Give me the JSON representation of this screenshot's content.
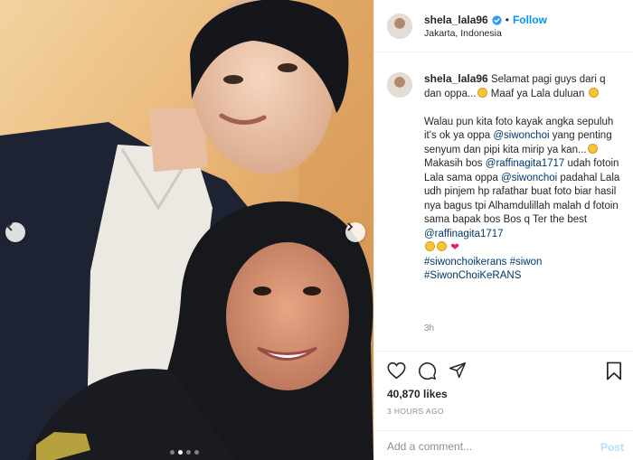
{
  "post": {
    "username": "shela_lala96",
    "follow_label": "Follow",
    "separator": "•",
    "location": "Jakarta, Indonesia",
    "caption": {
      "line1": "Selamat pagi guys dari q dan oppa...",
      "line1b": "Maaf ya Lala duluan",
      "para2_a": "Walau pun kita foto kayak angka sepuluh it's ok ya oppa ",
      "mention1": "@siwonchoi",
      "para2_b": " yang penting senyum dan pipi kita mirip ya kan...",
      "para2_c": " Makasih bos ",
      "mention2": "@raffinagita1717",
      "para2_d": " udah fotoin Lala sama oppa ",
      "mention3": "@siwonchoi",
      "para2_e": " padahal Lala udh pinjem hp rafathar buat foto biar hasil nya bagus tpi Alhamdulillah malah d fotoin sama bapak bos Bos q Ter the best ",
      "mention4": "@raffinagita1717",
      "heart": "❤",
      "tag1": "#siwonchoikerans",
      "tag2": "#siwon",
      "tag3": "#SiwonChoiKeRANS"
    },
    "age": "3h",
    "likes": "40,870 likes",
    "time": "3 HOURS AGO",
    "comment_placeholder": "Add a comment...",
    "post_label": "Post"
  },
  "carousel": {
    "slide_count": 4,
    "active_index": 1
  },
  "colors": {
    "link": "#00376b",
    "follow": "#0095f6",
    "verified": "#3897f0",
    "post_disabled": "#b2dffc"
  },
  "icons": [
    "verified-icon",
    "heart-icon",
    "comment-icon",
    "share-icon",
    "bookmark-icon",
    "chevron-left-icon",
    "chevron-right-icon"
  ]
}
